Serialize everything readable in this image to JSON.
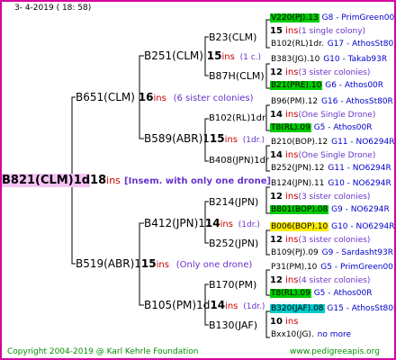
{
  "header": {
    "date": "3-  4-2019 ( 18:  58)"
  },
  "footer": {
    "copyright": "Copyright 2004-2019 @ Karl Kehrle Foundation",
    "url": "www.pedigreeapis.org"
  },
  "root": {
    "name": "B821(CLM)1d",
    "ins": "18",
    "ins_unit": "ins",
    "note": "[Insem. with only one drone]"
  },
  "gen1": [
    {
      "name": "B651(CLM)",
      "ins": "16",
      "ins_unit": "ins",
      "note": "(6 sister colonies)"
    },
    {
      "name": "B519(ABR)1",
      "ins": "15",
      "ins_unit": "ins",
      "note": "(Only one drone)"
    }
  ],
  "gen2": [
    {
      "name": "B251(CLM)",
      "ins": "15",
      "ins_unit": "ins",
      "note": "(1 c.)"
    },
    {
      "name": "B589(ABR)1",
      "ins": "15",
      "ins_unit": "ins",
      "note": "(1dr.)"
    },
    {
      "name": "B412(JPN)1",
      "ins": "14",
      "ins_unit": "ins",
      "note": "(1dr.)"
    },
    {
      "name": "B105(PM)1d",
      "ins": "14",
      "ins_unit": "ins",
      "note": "(1dr.)"
    }
  ],
  "gen3": [
    {
      "name": "B23(CLM)"
    },
    {
      "name": "B87H(CLM)"
    },
    {
      "name": "B102(RL)1dr"
    },
    {
      "name": "B408(JPN)1dr"
    },
    {
      "name": "B214(JPN)"
    },
    {
      "name": "B252(JPN)"
    },
    {
      "name": "B170(PM)"
    },
    {
      "name": "B130(JAF)"
    }
  ],
  "gen4": [
    {
      "top": "V220(PJ).13",
      "top_hl": "#00cc00",
      "top_code": "G8 - PrimGreen00",
      "mid_ins": "15",
      "mid_note": "(1 single colony)",
      "bot": "B102(RL)1dr.",
      "bot_code": "G17 - AthosSt80R"
    },
    {
      "top": "B383(JG).10",
      "top_hl": "",
      "top_code": "G10 - Takab93R",
      "mid_ins": "12",
      "mid_note": "(3 sister colonies)",
      "bot": "B21(PRE).10",
      "bot_hl": "#00cc00",
      "bot_code": "G6 - Athos00R"
    },
    {
      "top": "B96(PM).12",
      "top_hl": "",
      "top_code": "G16 - AthosSt80R",
      "mid_ins": "14",
      "mid_note": "(One Single Drone)",
      "bot": "T8(RL).09",
      "bot_hl": "#00cc00",
      "bot_code": "G5 - Athos00R"
    },
    {
      "top": "B210(BOP).12",
      "top_hl": "",
      "top_code": "G11 - NO6294R",
      "mid_ins": "14",
      "mid_note": "(One Single Drone)",
      "bot": "B252(JPN).12",
      "bot_code": "G11 - NO6294R"
    },
    {
      "top": "B124(JPN).11",
      "top_hl": "",
      "top_code": "G10 - NO6294R",
      "mid_ins": "12",
      "mid_note": "(3 sister colonies)",
      "bot": "B801(BOP).08",
      "bot_hl": "#00cc00",
      "bot_code": "G9 - NO6294R"
    },
    {
      "top": "B006(BOP).10",
      "top_hl": "#ffee00",
      "top_code": "G10 - NO6294R",
      "mid_ins": "12",
      "mid_note": "(3 sister colonies)",
      "bot": "B109(PJ).09",
      "bot_code": "G9 - Sardasht93R"
    },
    {
      "top": "P31(PM).10",
      "top_hl": "",
      "top_code": "G5 - PrimGreen00",
      "mid_ins": "12",
      "mid_note": "(4 sister colonies)",
      "bot": "T8(RL).09",
      "bot_hl": "#00cc00",
      "bot_code": "G5 - Athos00R"
    },
    {
      "top": "B320(JAF).08",
      "top_hl": "#00cccc",
      "top_code": "G15 - AthosSt80R",
      "mid_ins": "10",
      "mid_note": "",
      "bot": "Bxx10(JG).",
      "bot_code": "no more"
    }
  ],
  "colors": {
    "frame": "#d400a0",
    "root_hl": "#f4c4f4",
    "ins": "#cc0000",
    "note": "#6633cc",
    "code": "#0000cc",
    "copyright": "#009000"
  }
}
